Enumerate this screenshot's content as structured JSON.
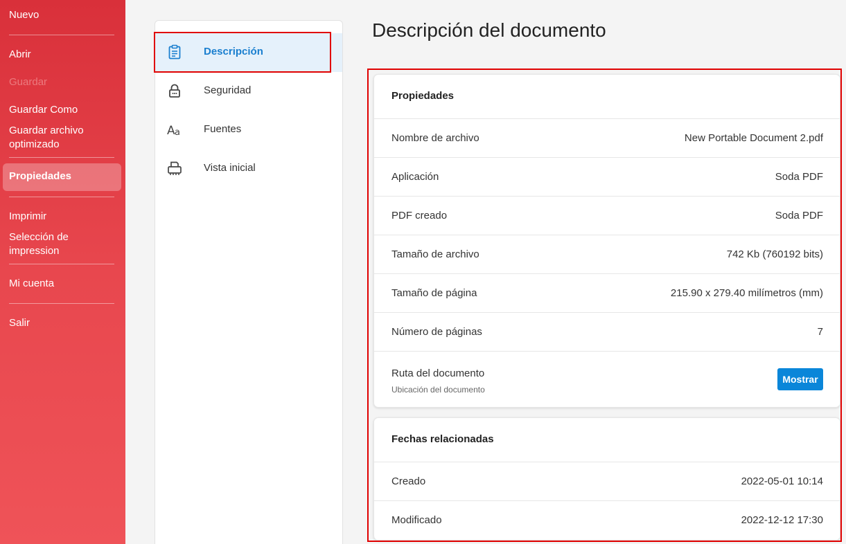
{
  "sidebar": {
    "items": [
      {
        "label": "Nuevo"
      },
      {
        "label": "Abrir"
      },
      {
        "label": "Guardar"
      },
      {
        "label": "Guardar Como"
      },
      {
        "label": "Guardar archivo optimizado"
      },
      {
        "label": "Propiedades"
      },
      {
        "label": "Imprimir"
      },
      {
        "label": "Selección de impression"
      },
      {
        "label": "Mi cuenta"
      },
      {
        "label": "Salir"
      }
    ]
  },
  "nav": {
    "items": [
      {
        "label": "Descripción",
        "icon": "clipboard-icon"
      },
      {
        "label": "Seguridad",
        "icon": "lock-icon"
      },
      {
        "label": "Fuentes",
        "icon": "font-icon"
      },
      {
        "label": "Vista inicial",
        "icon": "printer-icon"
      }
    ]
  },
  "main": {
    "title": "Descripción del documento",
    "properties": {
      "heading": "Propiedades",
      "rows": [
        {
          "key": "Nombre de archivo",
          "value": "New Portable Document 2.pdf"
        },
        {
          "key": "Aplicación",
          "value": "Soda PDF"
        },
        {
          "key": "PDF creado",
          "value": "Soda PDF"
        },
        {
          "key": "Tamaño de archivo",
          "value": "742 Kb (760192 bits)"
        },
        {
          "key": "Tamaño de página",
          "value": "215.90 x 279.40 milímetros (mm)"
        },
        {
          "key": "Número de páginas",
          "value": "7"
        }
      ],
      "path": {
        "key": "Ruta del documento",
        "sub": "Ubicación del documento",
        "button": "Mostrar"
      }
    },
    "dates": {
      "heading": "Fechas relacionadas",
      "rows": [
        {
          "key": "Creado",
          "value": "2022-05-01 10:14"
        },
        {
          "key": "Modificado",
          "value": "2022-12-12 17:30"
        }
      ]
    }
  },
  "colors": {
    "sidebar_red": "#e0383f",
    "accent_blue": "#0a86d9",
    "highlight_red": "#e00000"
  }
}
